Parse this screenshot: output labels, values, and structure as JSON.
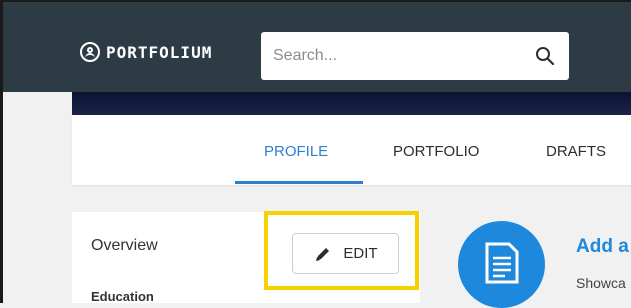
{
  "header": {
    "brand": "PORTFOLIUM",
    "search": {
      "placeholder": "Search..."
    }
  },
  "tabs": [
    {
      "label": "PROFILE",
      "active": true
    },
    {
      "label": "PORTFOLIO",
      "active": false
    },
    {
      "label": "DRAFTS",
      "active": false
    }
  ],
  "sidebar": {
    "items": [
      {
        "label": "Overview"
      },
      {
        "label": "Education"
      }
    ]
  },
  "edit_button": {
    "label": "EDIT"
  },
  "add_card": {
    "title": "Add a",
    "subtitle": "Showca"
  },
  "colors": {
    "navbar": "#2d3b45",
    "accent": "#2d7fd0",
    "highlight": "#f6d000",
    "circle": "#1d88dc"
  }
}
